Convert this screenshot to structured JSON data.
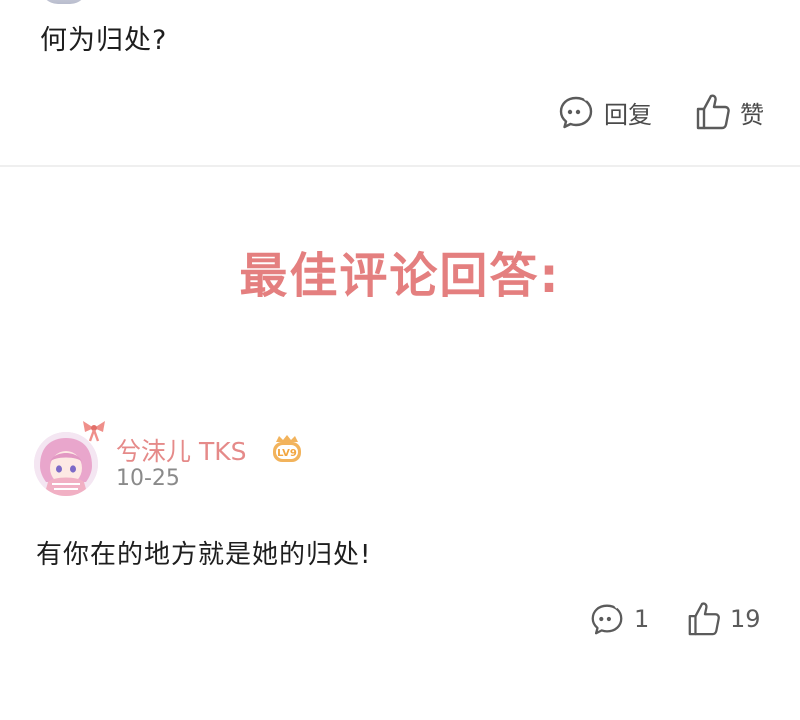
{
  "question": {
    "text": "何为归处?"
  },
  "question_actions": {
    "reply_label": "回复",
    "like_label": "赞"
  },
  "heading": {
    "text": "最佳评论回答:"
  },
  "comment": {
    "username": "兮沫儿 TKS",
    "level_badge": "LV9",
    "date": "10-25",
    "text": "有你在的地方就是她的归处!",
    "reply_count": "1",
    "like_count": "19"
  },
  "colors": {
    "accent_pink": "#e47f7f",
    "username_pink": "#e58a89",
    "badge_orange": "#f2b35c",
    "icon_gray": "#5b5b5b",
    "divider": "#efefef"
  },
  "icons": [
    "comment-bubble-icon",
    "thumbs-up-icon",
    "bow-icon",
    "level-badge-icon"
  ]
}
